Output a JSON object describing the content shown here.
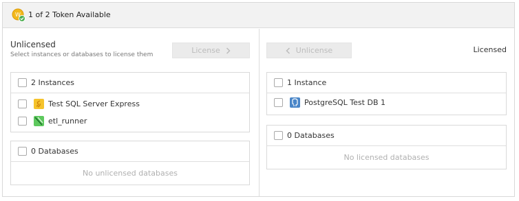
{
  "header": {
    "token_text": "1 of 2 Token Available",
    "icon": "token-coin-icon"
  },
  "unlicensed": {
    "title": "Unlicensed",
    "subtitle": "Select instances or databases to license them",
    "license_button": "License",
    "instances_header": "2 Instances",
    "instances": [
      {
        "label": "Test SQL Server Express",
        "icon": "sql-server-icon"
      },
      {
        "label": "etl_runner",
        "icon": "etl-runner-icon"
      }
    ],
    "databases_header": "0 Databases",
    "databases_empty": "No unlicensed databases"
  },
  "licensed": {
    "title": "Licensed",
    "unlicense_button": "Unlicense",
    "instances_header": "1 Instance",
    "instances": [
      {
        "label": "PostgreSQL Test DB 1",
        "icon": "postgresql-icon"
      }
    ],
    "databases_header": "0 Databases",
    "databases_empty": "No licensed databases"
  },
  "colors": {
    "token_gold": "#f2b81c",
    "check_green": "#4caf50",
    "disabled_button": "#ebebeb"
  }
}
